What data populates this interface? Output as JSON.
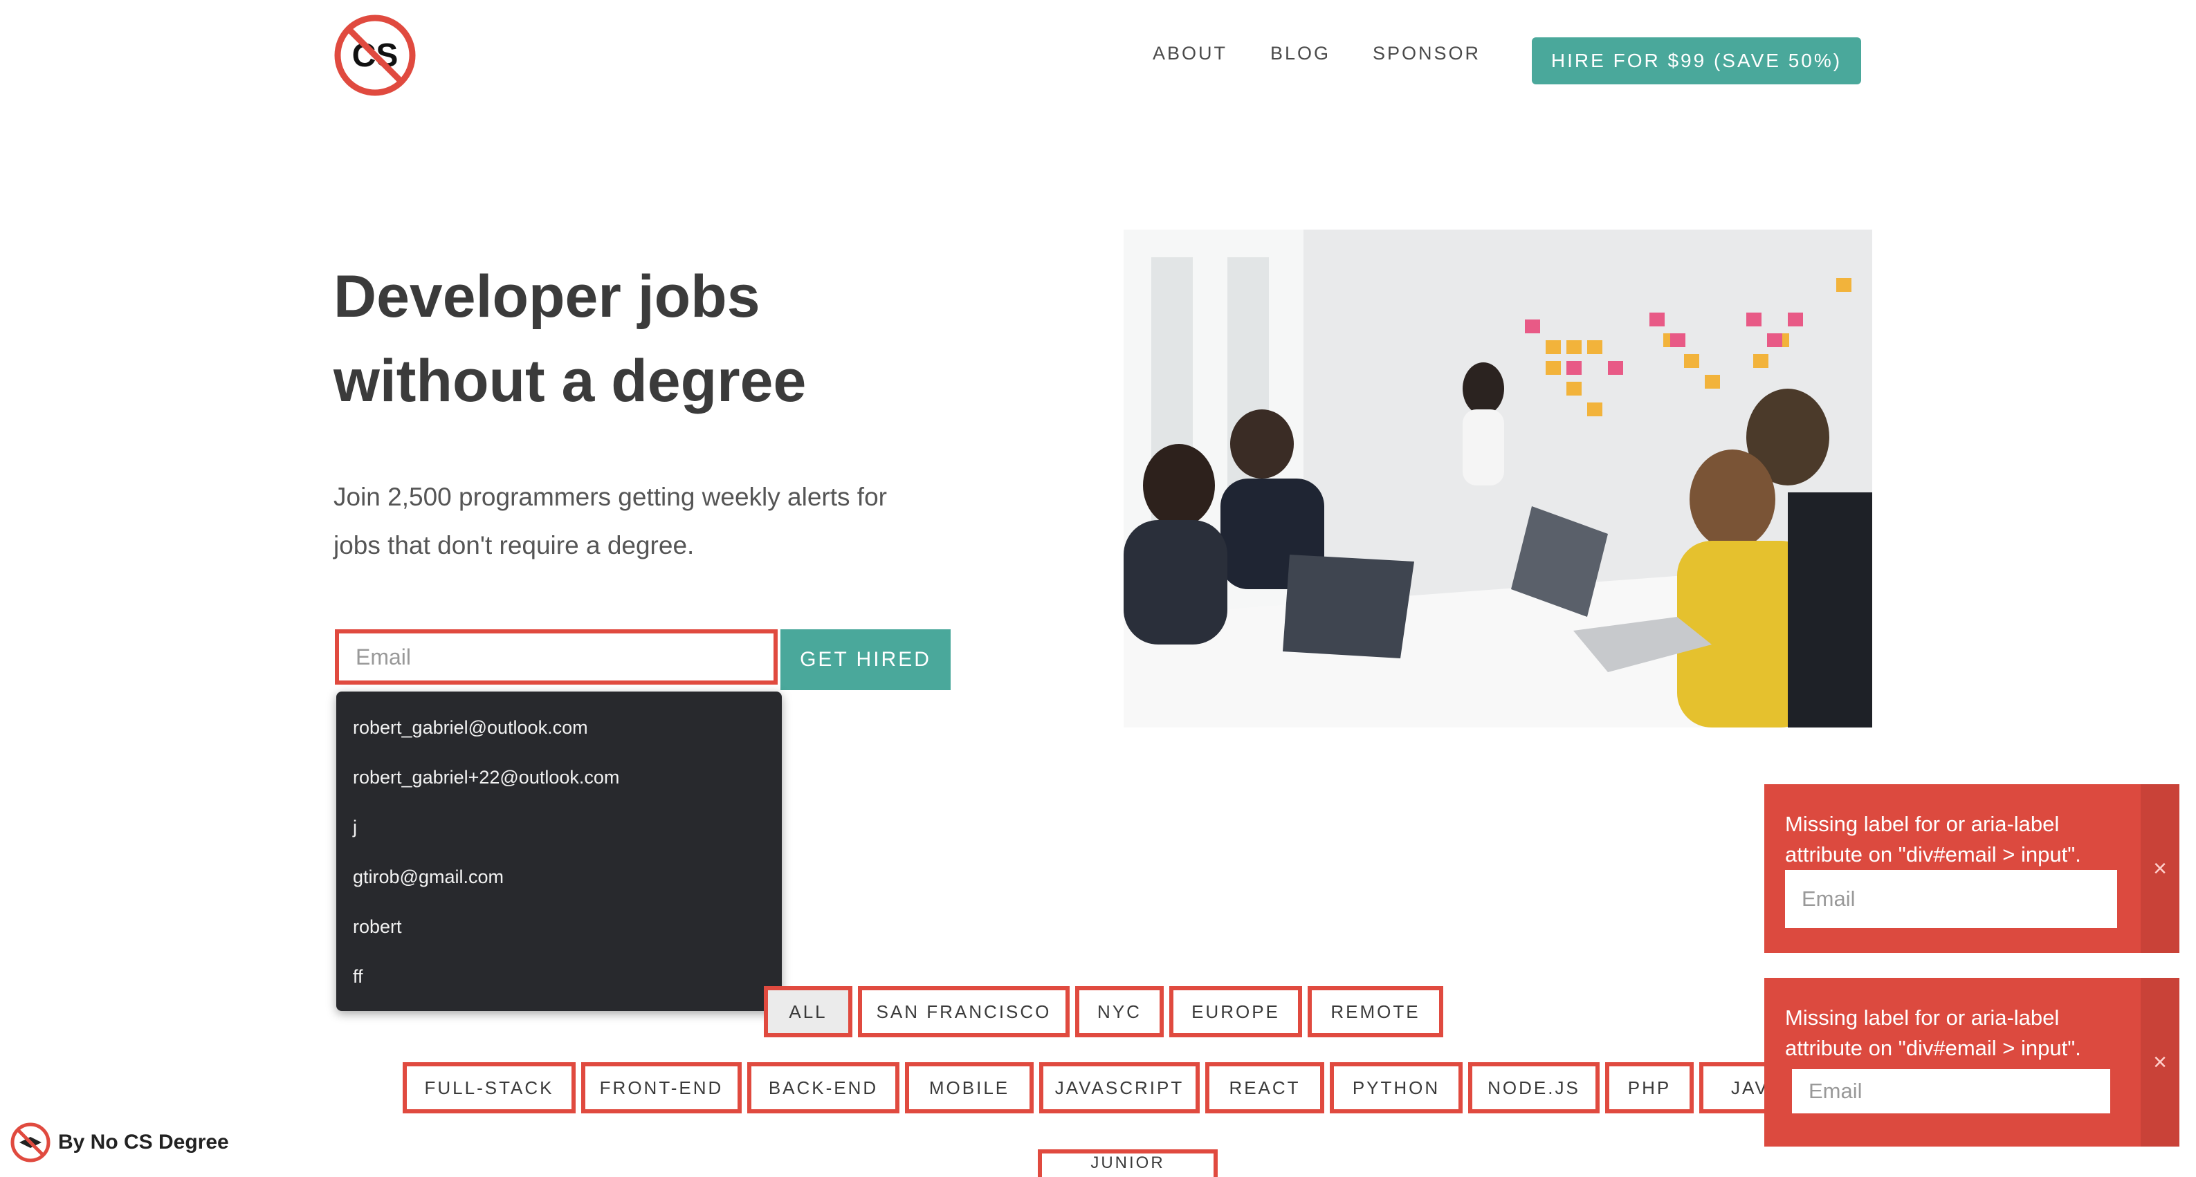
{
  "header": {
    "logo_text": "CS",
    "nav": [
      {
        "label": "ABOUT"
      },
      {
        "label": "BLOG"
      },
      {
        "label": "SPONSOR"
      }
    ],
    "hire_button": "HIRE FOR $99 (SAVE 50%)"
  },
  "hero": {
    "title_line1": "Developer jobs",
    "title_line2": "without a degree",
    "subtitle": "Join 2,500 programmers getting weekly alerts for jobs that don't require a degree.",
    "email_placeholder": "Email",
    "email_value": "",
    "submit_label": "GET HIRED"
  },
  "autocomplete": {
    "items": [
      "robert_gabriel@outlook.com",
      "robert_gabriel+22@outlook.com",
      "j",
      "gtirob@gmail.com",
      "robert",
      "ff"
    ]
  },
  "filters": {
    "locations": [
      "ALL",
      "SAN FRANCISCO",
      "NYC",
      "EUROPE",
      "REMOTE"
    ],
    "active_location": "ALL",
    "roles": [
      "FULL-STACK",
      "FRONT-END",
      "BACK-END",
      "MOBILE",
      "JAVASCRIPT",
      "REACT",
      "PYTHON",
      "NODE.JS",
      "PHP",
      "JAVA"
    ],
    "level_partial": "JUNIOR"
  },
  "toasts": [
    {
      "message": "Missing label for or aria-label attribute on \"div#email > input\".",
      "field_placeholder": "Email",
      "close": "×"
    },
    {
      "message": "Missing label for or aria-label attribute on \"div#email > input\".",
      "field_placeholder": "Email",
      "close": "×"
    }
  ],
  "footer_badge": {
    "label": "By No CS Degree"
  },
  "colors": {
    "accent": "#4aa89b",
    "error": "#dc4a3f",
    "text": "#3a3a3a",
    "dropdown_bg": "#28292d"
  }
}
